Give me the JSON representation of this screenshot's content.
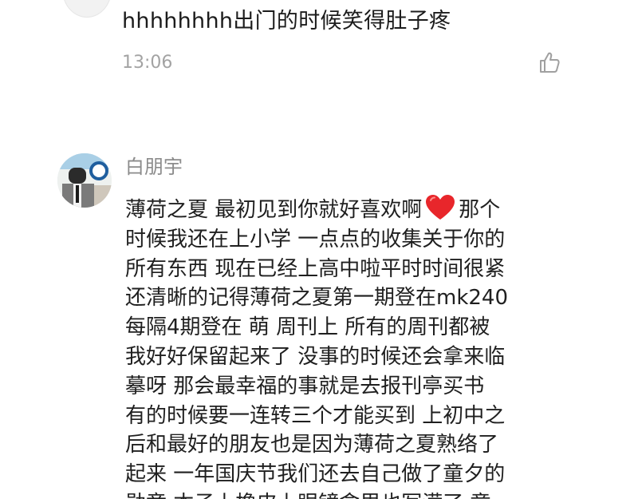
{
  "comments": [
    {
      "text": "hhhhhhhh出门的时候笑得肚子疼",
      "time": "13:06",
      "like_icon": "thumbs-up-icon"
    },
    {
      "username": "白朋宇",
      "lines": [
        {
          "before": "薄荷之夏 最初见到你就好喜欢啊",
          "emoji": "heart-icon",
          "after": "那个"
        },
        {
          "text": "时候我还在上小学 一点点的收集关于你的"
        },
        {
          "text": "所有东西 现在已经上高中啦平时时间很紧"
        },
        {
          "text": "还清晰的记得薄荷之夏第一期登在mk240"
        },
        {
          "text": "每隔4期登在 萌 周刊上 所有的周刊都被"
        },
        {
          "text": "我好好保留起来了 没事的时候还会拿来临"
        },
        {
          "text": "摹呀 那会最幸福的事就是去报刊亭买书"
        },
        {
          "text": "有的时候要一连转三个才能买到 上初中之"
        },
        {
          "text": "后和最好的朋友也是因为薄荷之夏熟络了"
        },
        {
          "text": "起来 一年国庆节我们还去自己做了童夕的"
        },
        {
          "text": "勋章 本子上橡皮上眼镜盒里也写满了 童"
        }
      ]
    }
  ],
  "colors": {
    "text": "#1f1f1f",
    "meta": "#a3a3a3",
    "username": "#8c8c8c",
    "heart": "#e8262b"
  }
}
